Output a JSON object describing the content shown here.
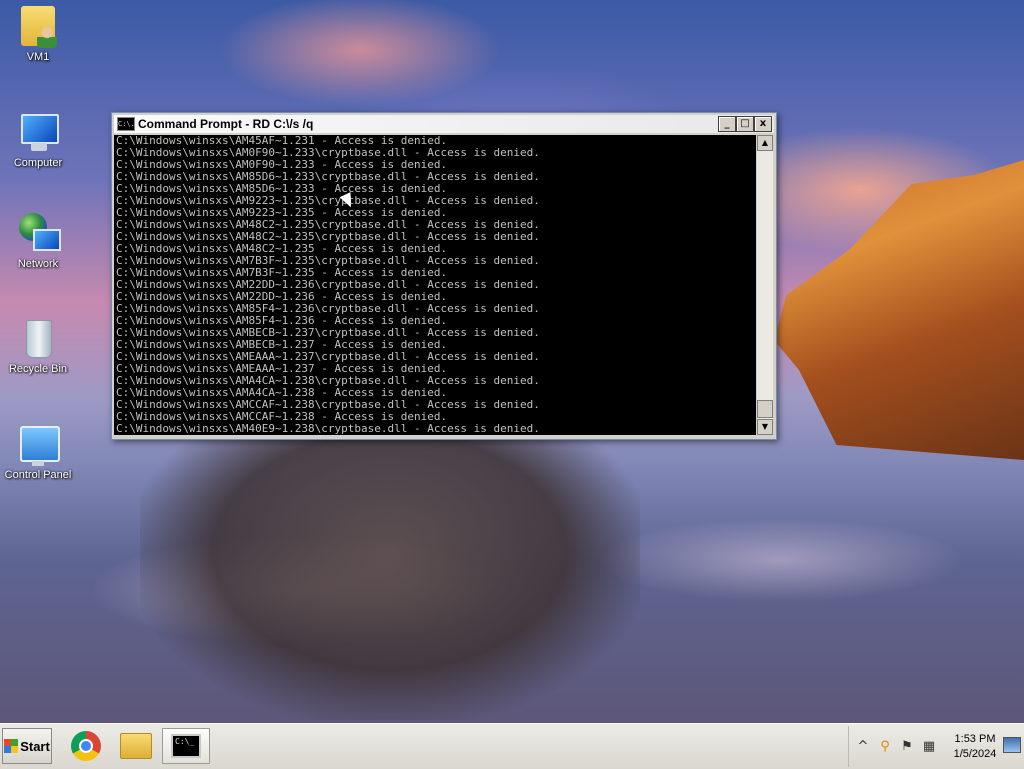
{
  "desktop": {
    "icons": [
      {
        "label": "VM1",
        "icon": "user-folder-icon"
      },
      {
        "label": "Computer",
        "icon": "computer-icon"
      },
      {
        "label": "Network",
        "icon": "network-icon"
      },
      {
        "label": "Recycle Bin",
        "icon": "recycle-bin-icon"
      },
      {
        "label": "Control Panel",
        "icon": "control-panel-icon"
      }
    ]
  },
  "window": {
    "title": "Command Prompt - RD  C:\\/s /q",
    "icon_text": "C:\\.",
    "minimize": "_",
    "maximize": "□",
    "close": "x",
    "lines": [
      "C:\\Windows\\winsxs\\AM45AF~1.231 - Access is denied.",
      "C:\\Windows\\winsxs\\AM0F90~1.233\\cryptbase.dll - Access is denied.",
      "C:\\Windows\\winsxs\\AM0F90~1.233 - Access is denied.",
      "C:\\Windows\\winsxs\\AM85D6~1.233\\cryptbase.dll - Access is denied.",
      "C:\\Windows\\winsxs\\AM85D6~1.233 - Access is denied.",
      "C:\\Windows\\winsxs\\AM9223~1.235\\cryptbase.dll - Access is denied.",
      "C:\\Windows\\winsxs\\AM9223~1.235 - Access is denied.",
      "C:\\Windows\\winsxs\\AM48C2~1.235\\cryptbase.dll - Access is denied.",
      "C:\\Windows\\winsxs\\AM48C2~1.235\\cryptbase.dll - Access is denied.",
      "C:\\Windows\\winsxs\\AM48C2~1.235 - Access is denied.",
      "C:\\Windows\\winsxs\\AM7B3F~1.235\\cryptbase.dll - Access is denied.",
      "C:\\Windows\\winsxs\\AM7B3F~1.235 - Access is denied.",
      "C:\\Windows\\winsxs\\AM22DD~1.236\\cryptbase.dll - Access is denied.",
      "C:\\Windows\\winsxs\\AM22DD~1.236 - Access is denied.",
      "C:\\Windows\\winsxs\\AM85F4~1.236\\cryptbase.dll - Access is denied.",
      "C:\\Windows\\winsxs\\AM85F4~1.236 - Access is denied.",
      "C:\\Windows\\winsxs\\AMBECB~1.237\\cryptbase.dll - Access is denied.",
      "C:\\Windows\\winsxs\\AMBECB~1.237 - Access is denied.",
      "C:\\Windows\\winsxs\\AMEAAA~1.237\\cryptbase.dll - Access is denied.",
      "C:\\Windows\\winsxs\\AMEAAA~1.237 - Access is denied.",
      "C:\\Windows\\winsxs\\AMA4CA~1.238\\cryptbase.dll - Access is denied.",
      "C:\\Windows\\winsxs\\AMA4CA~1.238 - Access is denied.",
      "C:\\Windows\\winsxs\\AMCCAF~1.238\\cryptbase.dll - Access is denied.",
      "C:\\Windows\\winsxs\\AMCCAF~1.238 - Access is denied.",
      "C:\\Windows\\winsxs\\AM40E9~1.238\\cryptbase.dll - Access is denied."
    ],
    "console_bg": "#000000",
    "console_fg": "#c0c0c0"
  },
  "taskbar": {
    "start_label": "Start",
    "pinned": [
      {
        "name": "chrome",
        "icon": "chrome-icon"
      },
      {
        "name": "file-explorer",
        "icon": "folder-icon"
      },
      {
        "name": "command-prompt",
        "icon": "cmd-icon",
        "active": true
      }
    ],
    "cmd_icon_text": "C:\\_",
    "tray": {
      "chevron": "^",
      "clock_time": "1:53 PM",
      "clock_date": "1/5/2024"
    }
  }
}
